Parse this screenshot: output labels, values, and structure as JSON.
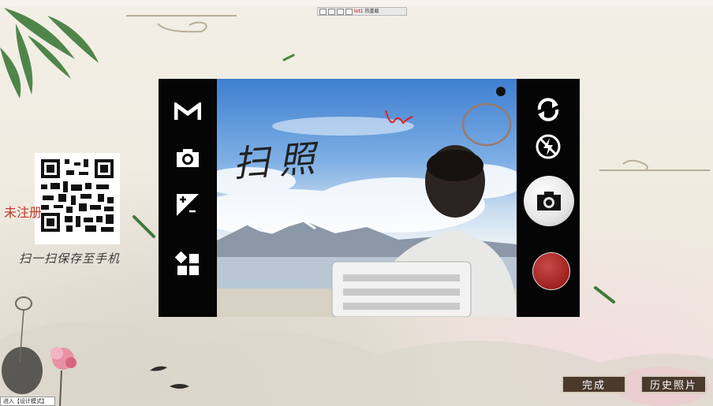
{
  "toolbar": {
    "counter": "lot1",
    "hot_label": "热重载"
  },
  "qr": {
    "caption": "扫一扫保存至手机",
    "watermark": "未注册"
  },
  "camera": {
    "left_icons": [
      "gmail-icon",
      "camera-icon",
      "exposure-icon",
      "apps-icon"
    ],
    "right_icons": [
      "switch-camera-icon",
      "flash-off-icon",
      "shutter-camera-icon",
      "record-button"
    ],
    "handwriting": "扫照"
  },
  "actions": {
    "done_label": "完成",
    "history_label": "历史照片"
  },
  "status": {
    "mode_text": "进入【设计模式】"
  },
  "colors": {
    "record_red": "#a11f1f",
    "button_brown": "#4a3a2c",
    "watermark_red": "#c0392b"
  }
}
